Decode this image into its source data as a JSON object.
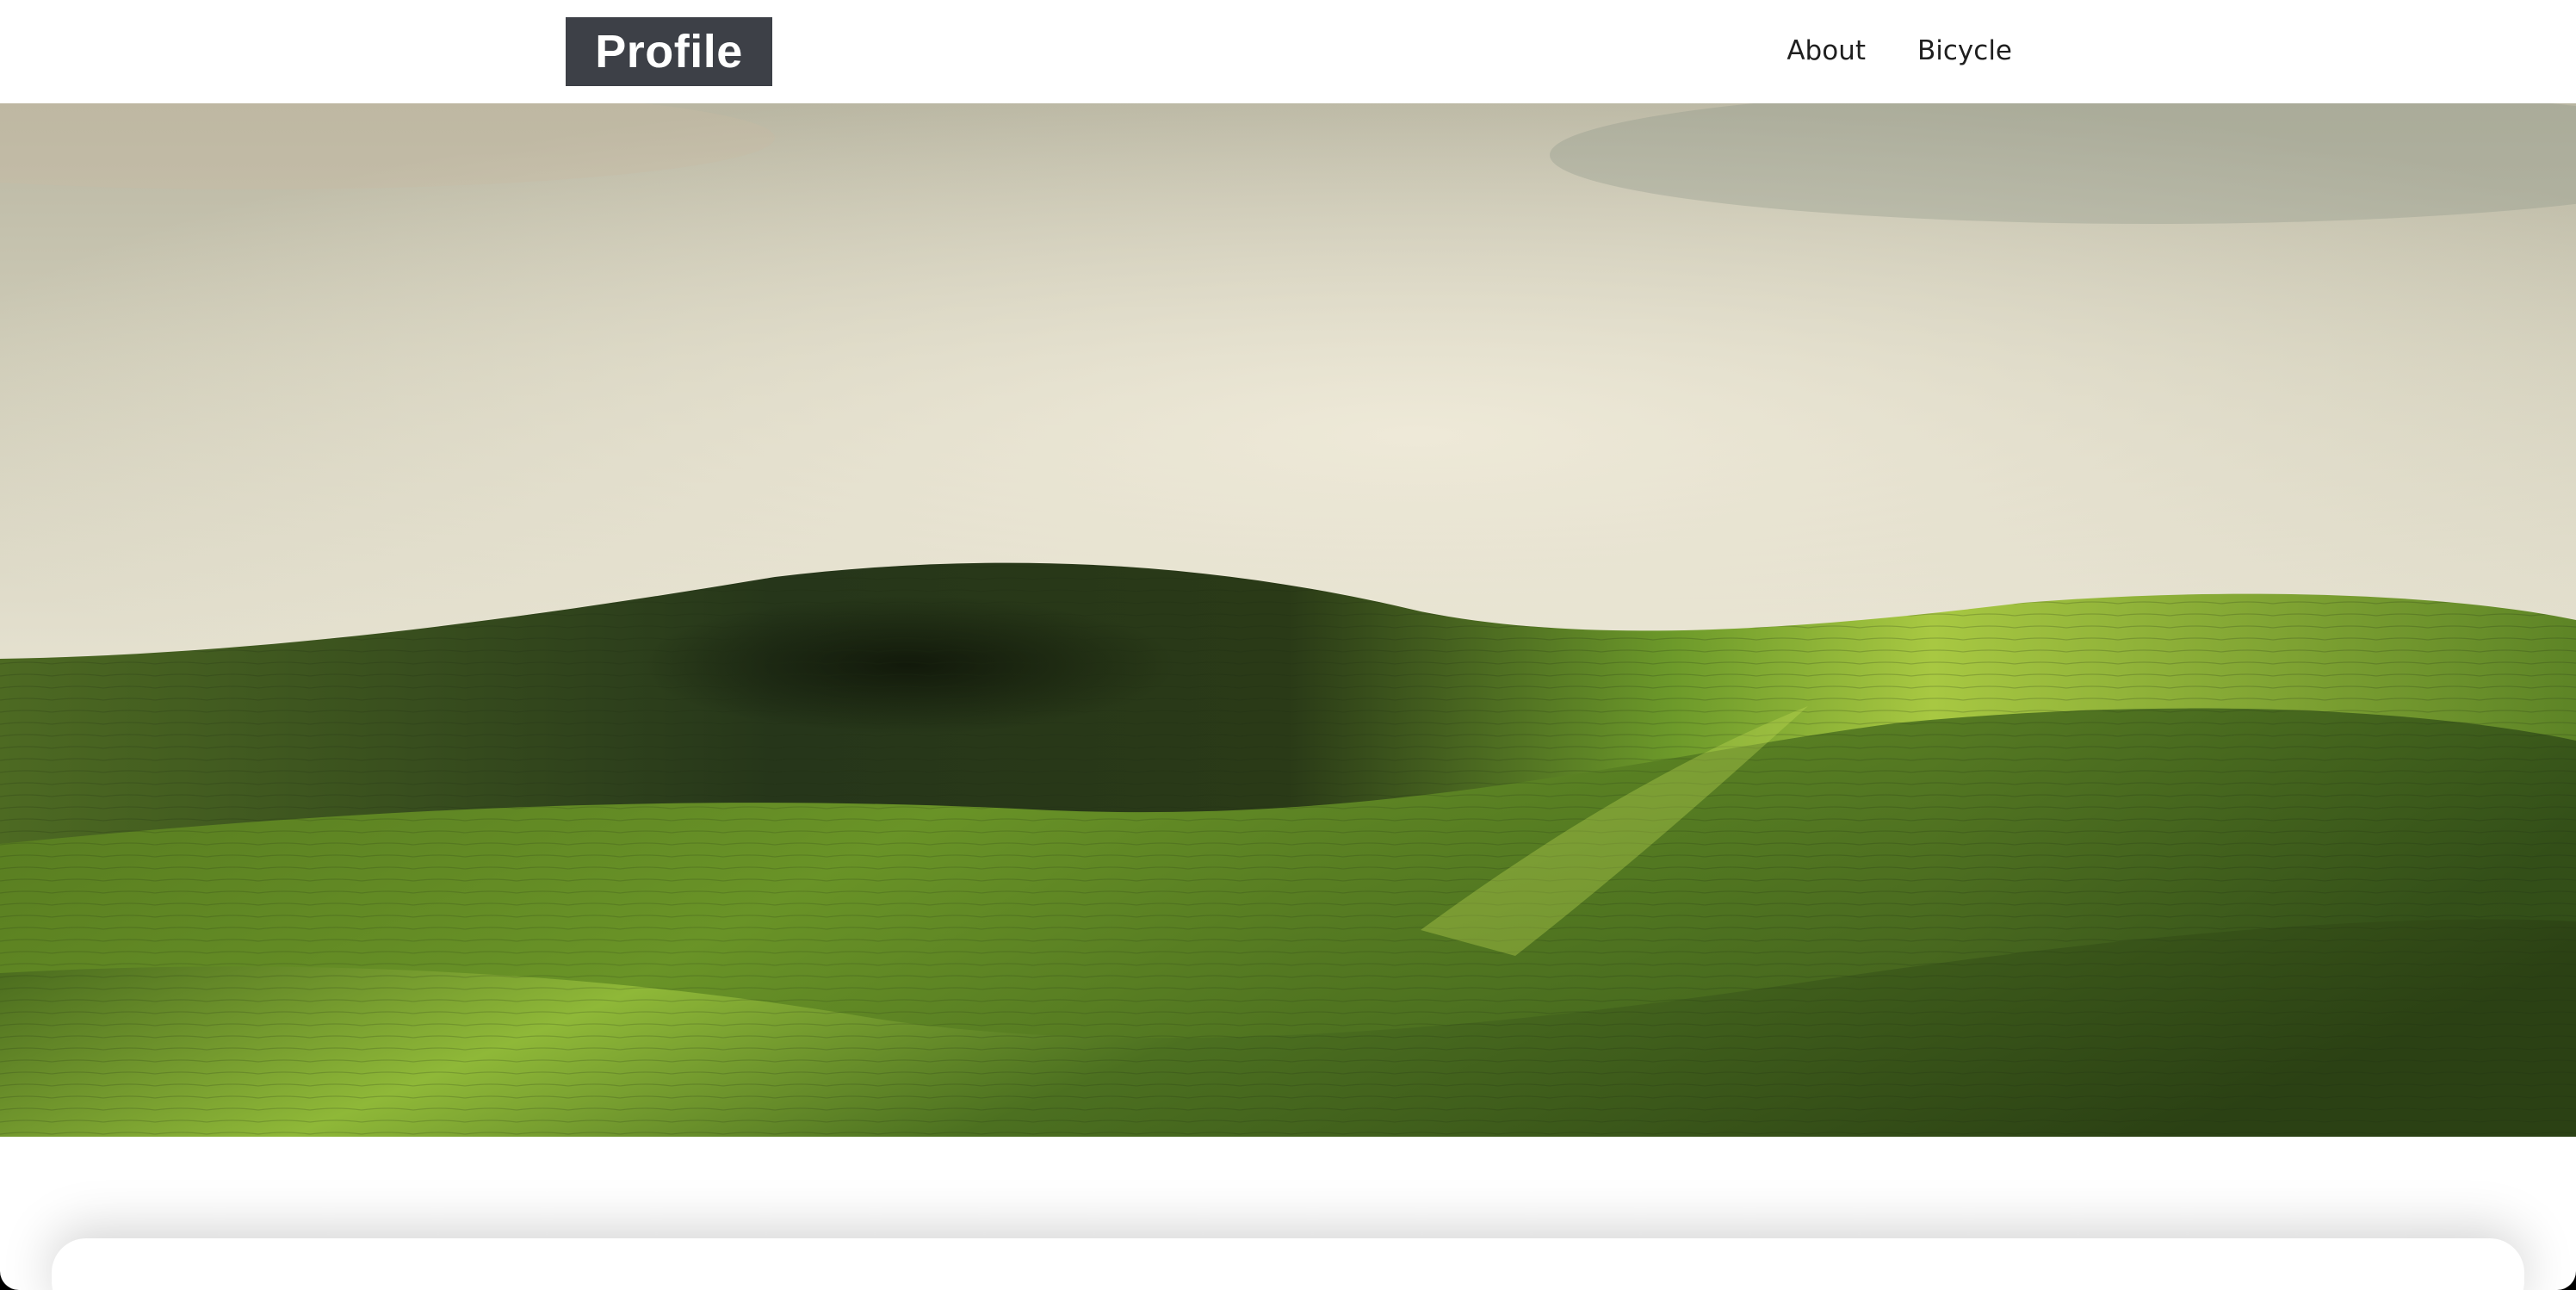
{
  "header": {
    "logo_text": "Profile",
    "nav": [
      {
        "label": "About"
      },
      {
        "label": "Bicycle"
      }
    ]
  },
  "hero": {
    "image": "rolling-green-hills-landscape"
  },
  "colors": {
    "logo_bg": "#3d4047",
    "logo_text": "#ffffff",
    "nav_text": "#1f1f1f",
    "page_bg": "#ffffff"
  }
}
